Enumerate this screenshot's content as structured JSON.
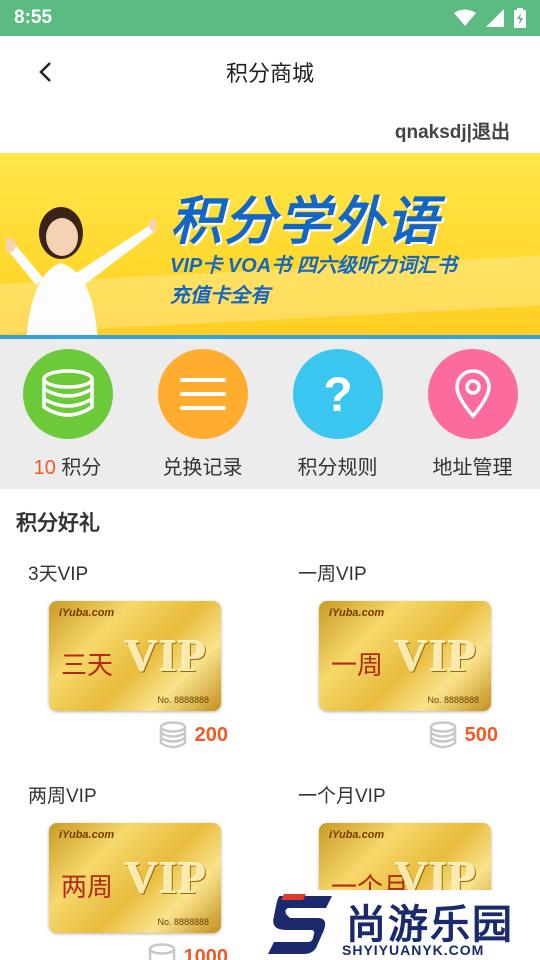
{
  "status_bar": {
    "time": "8:55"
  },
  "nav": {
    "title": "积分商城"
  },
  "user": {
    "text": "qnaksdj|退出"
  },
  "banner": {
    "title": "积分学外语",
    "line1": "VIP卡   VOA书   四六级听力词汇书",
    "line2": "充值卡全有"
  },
  "menu": [
    {
      "number": "10",
      "label": "积分",
      "icon": "coins-icon",
      "color": "#6cc93a"
    },
    {
      "label": "兑换记录",
      "icon": "list-icon",
      "color": "#ffac2f"
    },
    {
      "label": "积分规则",
      "icon": "question-icon",
      "color": "#3bc6f0"
    },
    {
      "label": "地址管理",
      "icon": "location-pin-icon",
      "color": "#fb6b9d"
    }
  ],
  "section": {
    "title": "积分好礼"
  },
  "products": [
    {
      "name": "3天VIP",
      "card_text": "三天",
      "card_vip": "VIP",
      "price": "200"
    },
    {
      "name": "一周VIP",
      "card_text": "一周",
      "card_vip": "VIP",
      "price": "500"
    },
    {
      "name": "两周VIP",
      "card_text": "两周",
      "card_vip": "VIP",
      "price": "1000"
    },
    {
      "name": "一个月VIP",
      "card_text": "一个月",
      "card_vip": "VIP",
      "price": ""
    }
  ],
  "card_common": {
    "logo": "iYuba.com",
    "number": "No. 8888888"
  },
  "watermark": {
    "main": "尚游乐园",
    "sub": "SHYIYUANYK.COM"
  }
}
